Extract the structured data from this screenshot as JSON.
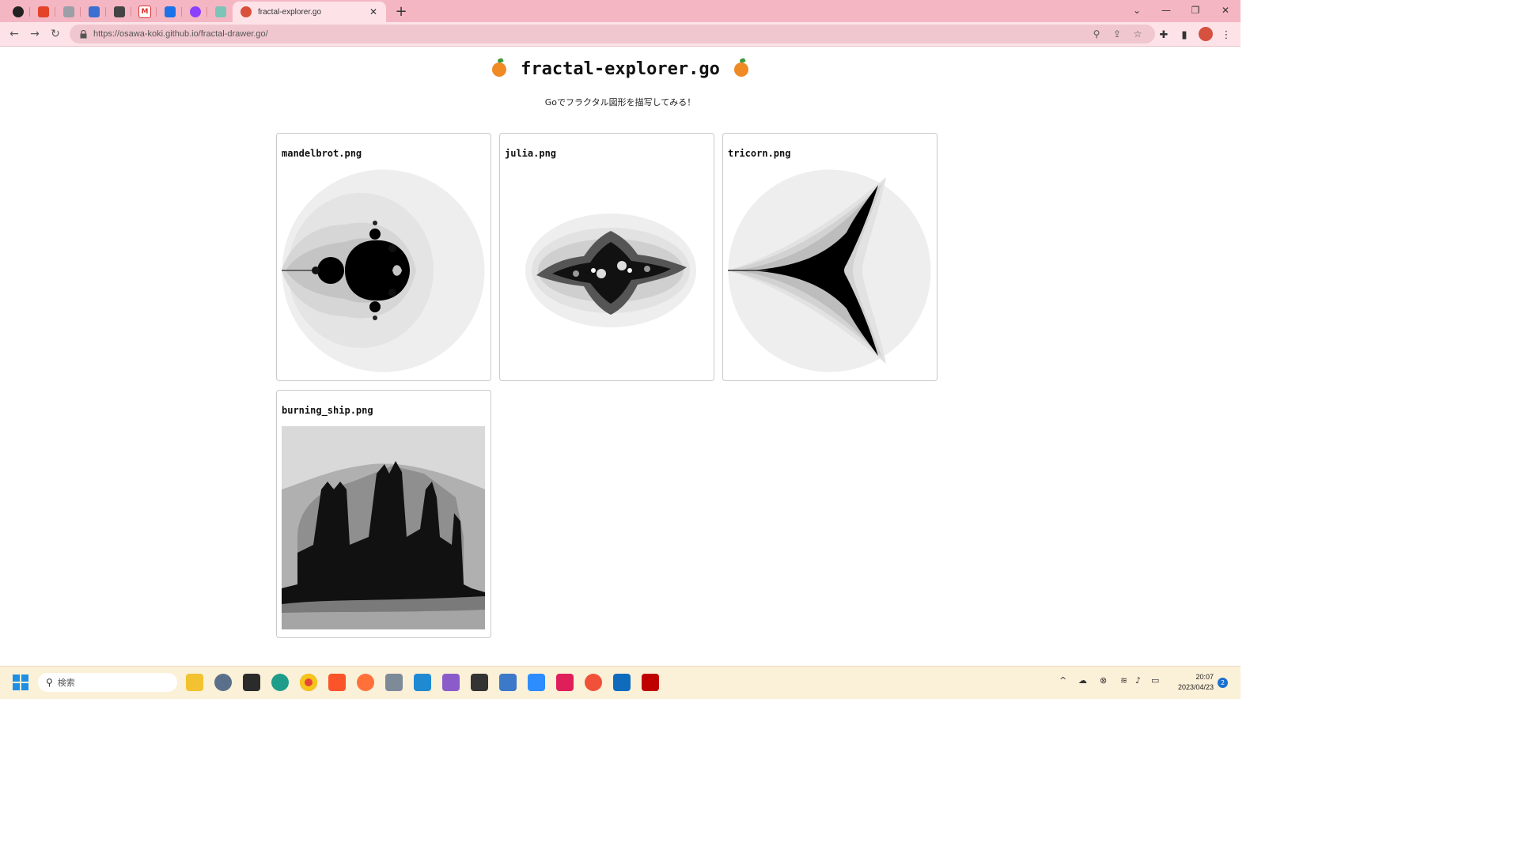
{
  "browser": {
    "active_tab_title": "fractal-explorer.go",
    "url": "https://osawa-koki.github.io/fractal-drawer.go/",
    "pinned_tabs": [
      "github-icon",
      "gitlab-icon",
      "hexagon-icon",
      "grid-app-icon",
      "butterfly-icon",
      "gmail-icon",
      "calendar-icon",
      "circle-app-icon",
      "chat-app-icon"
    ]
  },
  "page": {
    "title": "fractal-explorer.go",
    "subtitle": "Goでフラクタル図形を描写してみる！",
    "cards": [
      {
        "caption": "mandelbrot.png"
      },
      {
        "caption": "julia.png"
      },
      {
        "caption": "tricorn.png"
      },
      {
        "caption": "burning_ship.png"
      }
    ]
  },
  "taskbar": {
    "search_placeholder": "検索",
    "time": "20:07",
    "date": "2023/04/23",
    "notification_count": "2",
    "apps": [
      "file-explorer-icon",
      "settings-icon",
      "terminal-icon",
      "edge-icon",
      "chrome-icon",
      "brave-icon",
      "firefox-icon",
      "remote-desktop-icon",
      "vscode-icon",
      "visual-studio-icon",
      "inkscape-icon",
      "notepad-icon",
      "zoom-icon",
      "slack-icon",
      "swift-icon",
      "network-app-icon",
      "kobo-icon"
    ]
  },
  "colors": {
    "tabstrip": "#f5b6c3",
    "toolbar": "#fde3e8",
    "taskbar": "#fbf0d8"
  }
}
